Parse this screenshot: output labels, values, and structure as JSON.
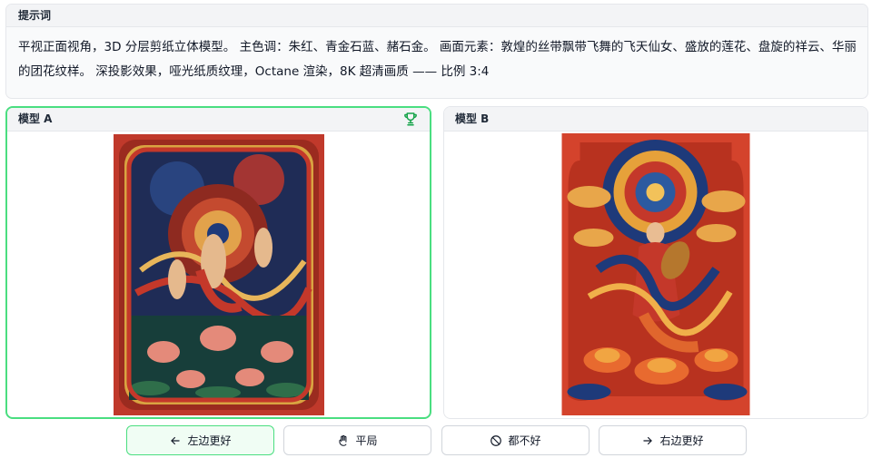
{
  "prompt": {
    "title": "提示词",
    "text": "平视正面视角，3D 分层剪纸立体模型。 主色调：朱红、青金石蓝、赭石金。 画面元素：敦煌的丝带飘带飞舞的飞天仙女、盛放的莲花、盘旋的祥云、华丽的团花纹样。 深投影效果，哑光纸质纹理，Octane 渲染，8K 超清画质 —— 比例 3:4"
  },
  "models": [
    {
      "label": "模型 A",
      "winner": true,
      "winner_icon": "trophy-icon"
    },
    {
      "label": "模型 B",
      "winner": false
    }
  ],
  "actions": {
    "left": {
      "label": "左边更好",
      "icon": "arrow-left-icon",
      "selected": true
    },
    "tie": {
      "label": "平局",
      "icon": "hand-icon"
    },
    "none": {
      "label": "都不好",
      "icon": "ban-icon"
    },
    "right": {
      "label": "右边更好",
      "icon": "arrow-right-icon"
    }
  },
  "colors": {
    "accent_green": "#4ade80",
    "vermilion": "#c4382a",
    "lapis": "#1e3a7a",
    "ochre_gold": "#d99a3a"
  }
}
